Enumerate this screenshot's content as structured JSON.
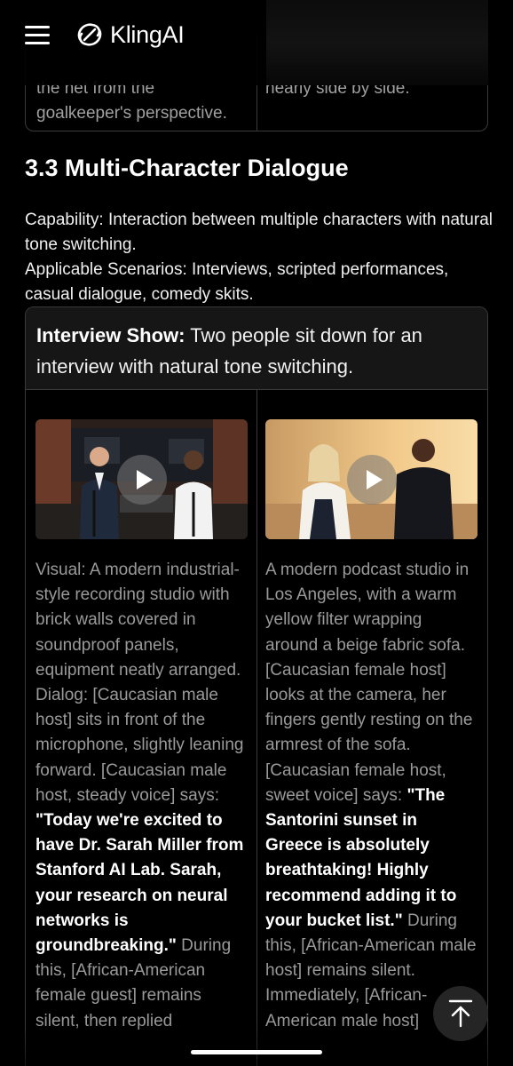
{
  "header": {
    "logo_text": "KlingAI",
    "menu_icon": "hamburger-menu-icon",
    "logo_icon": "kling-logo-icon"
  },
  "previous_table": {
    "left_tail": "the net from the goalkeeper's perspective.",
    "right_tail": "nearly side by side."
  },
  "section": {
    "title": "3.3 Multi-Character Dialogue",
    "capability": "Capability: Interaction between multiple characters with natural tone switching.",
    "scenarios": "Applicable Scenarios: Interviews, scripted performances, casual dialogue, comedy skits."
  },
  "card": {
    "heading_label": "Interview Show:",
    "heading_text": " Two people sit down for an interview with natural tone switching.",
    "left": {
      "video_icon": "play-icon",
      "text_before": "Visual: A modern industrial-style recording studio with brick walls covered in soundproof panels, equipment neatly arranged. Dialog: [Caucasian male host] sits in front of the microphone, slightly leaning forward. [Caucasian male host, steady voice] says: ",
      "quote": "\"Today we're excited to have Dr. Sarah Miller from Stanford AI Lab. Sarah, your research on neural networks is groundbreaking.\"",
      "text_after": " During this, [African-American female guest] remains silent, then replied"
    },
    "right": {
      "video_icon": "play-icon",
      "text_before": "A modern podcast studio in Los Angeles, with a warm yellow filter wrapping around a beige fabric sofa. [Caucasian female host] looks at the camera, her fingers gently resting on the armrest of the sofa. [Caucasian female host, sweet voice] says: ",
      "quote": "\"The Santorini sunset in Greece is absolutely breathtaking! Highly recommend adding it to your bucket list.\"",
      "text_after": " During this, [African-American male host] remains silent. Immediately, [African-American male host]"
    }
  },
  "floating": {
    "scroll_top_icon": "arrow-up-to-top-icon"
  },
  "colors": {
    "background": "#000000",
    "card_header": "#161616",
    "border": "#3a3a3a",
    "muted_text": "#9a9a9a"
  }
}
